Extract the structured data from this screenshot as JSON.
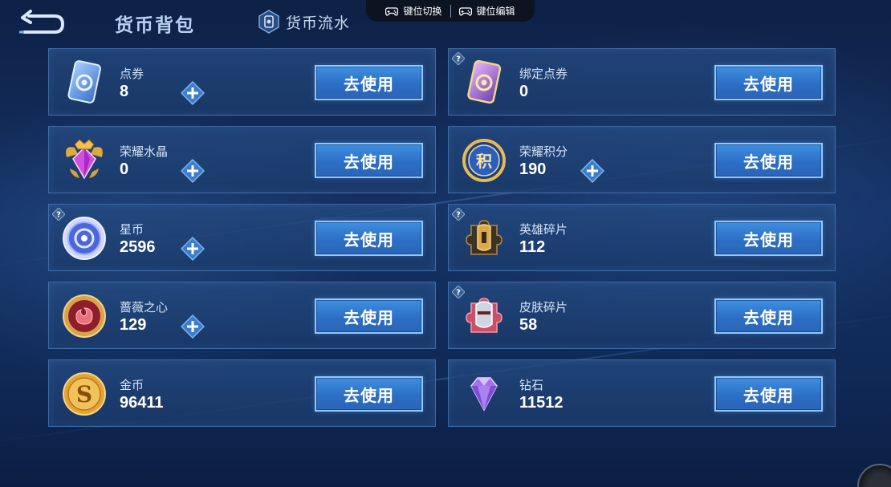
{
  "header": {
    "title": "货币背包",
    "flow_tab_label": "货币流水"
  },
  "key_controls": {
    "switch_label": "键位切换",
    "edit_label": "键位编辑"
  },
  "use_button_label": "去使用",
  "currencies": [
    {
      "name": "点券",
      "amount": "8",
      "icon": "coupon-card-icon",
      "has_plus": true,
      "has_help": false
    },
    {
      "name": "绑定点券",
      "amount": "0",
      "icon": "bound-coupon-card-icon",
      "has_plus": false,
      "has_help": true
    },
    {
      "name": "荣耀水晶",
      "amount": "0",
      "icon": "glory-crystal-icon",
      "has_plus": true,
      "has_help": false
    },
    {
      "name": "荣耀积分",
      "amount": "190",
      "icon": "glory-points-icon",
      "has_plus": true,
      "has_help": false
    },
    {
      "name": "星币",
      "amount": "2596",
      "icon": "star-coin-icon",
      "has_plus": true,
      "has_help": true
    },
    {
      "name": "英雄碎片",
      "amount": "112",
      "icon": "hero-fragment-icon",
      "has_plus": false,
      "has_help": true
    },
    {
      "name": "蔷薇之心",
      "amount": "129",
      "icon": "rose-heart-icon",
      "has_plus": true,
      "has_help": false
    },
    {
      "name": "皮肤碎片",
      "amount": "58",
      "icon": "skin-fragment-icon",
      "has_plus": false,
      "has_help": true
    },
    {
      "name": "金币",
      "amount": "96411",
      "icon": "gold-coin-icon",
      "has_plus": false,
      "has_help": false
    },
    {
      "name": "钻石",
      "amount": "11512",
      "icon": "diamond-icon",
      "has_plus": false,
      "has_help": false
    }
  ],
  "colors": {
    "accent_button": "#3f8fe0",
    "card_border": "#6ea0e1",
    "background": "#143163"
  }
}
